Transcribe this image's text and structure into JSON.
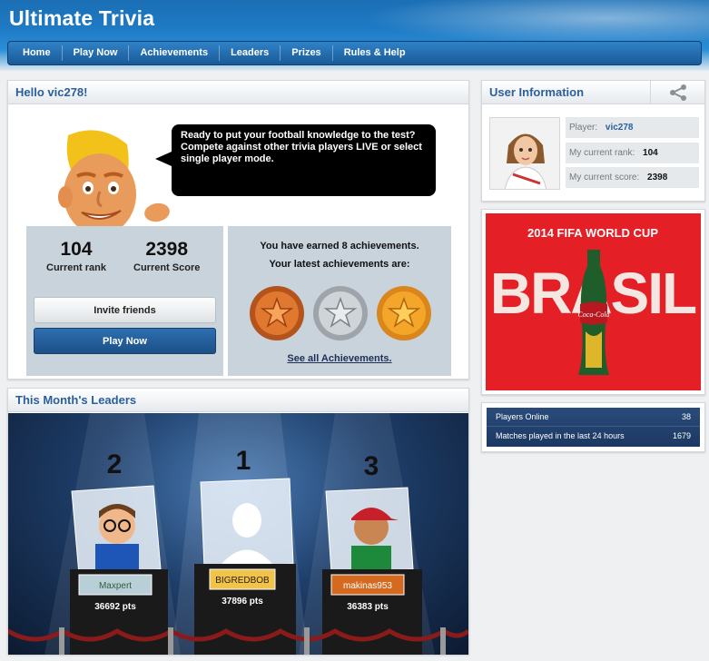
{
  "app": {
    "title": "Ultimate Trivia"
  },
  "nav": {
    "items": [
      "Home",
      "Play Now",
      "Achievements",
      "Leaders",
      "Prizes",
      "Rules & Help"
    ]
  },
  "hello": {
    "title": "Hello vic278!",
    "bubble": "Ready to put your football knowledge to the test? Compete against other trivia players LIVE or select single player mode.",
    "rank_value": "104",
    "rank_label": "Current rank",
    "score_value": "2398",
    "score_label": "Current Score",
    "invite_label": "Invite friends",
    "play_label": "Play Now",
    "achievements_earned": "You have earned 8 achievements.",
    "latest_label": "Your latest achievements are:",
    "see_all": "See all Achievements."
  },
  "leaders": {
    "title": "This Month's Leaders",
    "podium": [
      {
        "place": "2",
        "name": "Maxpert",
        "points": "36692 pts"
      },
      {
        "place": "1",
        "name": "BIGREDBOB",
        "points": "37896 pts"
      },
      {
        "place": "3",
        "name": "makinas953",
        "points": "36383 pts"
      }
    ]
  },
  "user_info": {
    "title": "User Information",
    "player_label": "Player:",
    "player_value": "vic278",
    "rank_label": "My current rank:",
    "rank_value": "104",
    "score_label": "My current score:",
    "score_value": "2398"
  },
  "ad": {
    "year_line": "2014 FIFA WORLD CUP",
    "word": "BRASIL",
    "brand": "Coca-Cola"
  },
  "stats": {
    "online_label": "Players Online",
    "online_value": "38",
    "matches_label": "Matches played in the last 24 hours",
    "matches_value": "1679"
  },
  "colors": {
    "accent": "#2b5f9c",
    "nav": "#1a5a98",
    "ad_red": "#e41f26"
  }
}
